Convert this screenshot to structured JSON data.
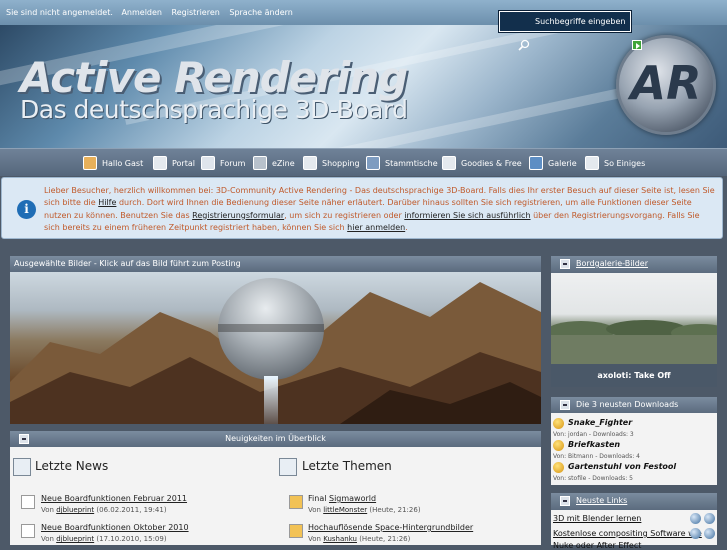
{
  "topbar": {
    "status": "Sie sind nicht angemeldet.",
    "links": [
      "Anmelden",
      "Registrieren",
      "Sprache ändern"
    ]
  },
  "header": {
    "logo_title": "Active Rendering",
    "logo_subtitle": "Das deutschsprachige 3D-Board",
    "badge": "AR",
    "search_placeholder": "Suchbegriffe eingeben"
  },
  "nav": {
    "items": [
      {
        "label": "Hallo Gast",
        "icon": "user-icon"
      },
      {
        "label": "Portal",
        "icon": "home-icon"
      },
      {
        "label": "Forum",
        "icon": "forum-icon"
      },
      {
        "label": "eZine",
        "icon": "ar-icon"
      },
      {
        "label": "Shopping",
        "icon": "cart-icon"
      },
      {
        "label": "Stammtische",
        "icon": "people-icon"
      },
      {
        "label": "Goodies & Free",
        "icon": "gift-icon"
      },
      {
        "label": "Galerie",
        "icon": "gallery-icon"
      },
      {
        "label": "So Einiges",
        "icon": "misc-icon"
      }
    ]
  },
  "notice": {
    "p1": "Lieber Besucher, herzlich willkommen bei: 3D-Community Active Rendering - Das deutschsprachige 3D-Board. Falls dies Ihr erster Besuch auf dieser Seite ist, lesen Sie sich bitte die ",
    "hilfe": "Hilfe",
    "p2": " durch. Dort wird Ihnen die Bedienung dieser Seite näher erläutert. Darüber hinaus sollten Sie sich registrieren, um alle Funktionen dieser Seite nutzen zu können. Benutzen Sie das ",
    "form": "Registrierungsformular",
    "p3": ", um sich zu registrieren oder ",
    "info": "informieren Sie sich ausführlich",
    "p4": " über den Registrierungsvorgang. Falls Sie sich bereits zu einem früheren Zeitpunkt registriert haben, können Sie sich ",
    "anmelden": "hier anmelden",
    "p5": "."
  },
  "featured": {
    "title": "Ausgewählte Bilder - Klick auf das Bild führt zum Posting"
  },
  "news_panel": {
    "title": "Neuigkeiten im Überblick",
    "news_heading": "Letzte News",
    "themes_heading": "Letzte Themen",
    "news": [
      {
        "title": "Neue Boardfunktionen Februar 2011",
        "by": "Von",
        "author": "djblueprint",
        "date": "(06.02.2011, 19:41)"
      },
      {
        "title": "Neue Boardfunktionen Oktober 2010",
        "by": "Von",
        "author": "djblueprint",
        "date": "(17.10.2010, 15:09)"
      }
    ],
    "themes": [
      {
        "title_prefix": "Final ",
        "title": "Sigmaworld",
        "by": "Von",
        "author": "littleMonster",
        "date": "(Heute, 21:26)"
      },
      {
        "title_prefix": "",
        "title": "Hochauflösende Space-Hintergrundbilder",
        "by": "Von",
        "author": "Kushanku",
        "date": "(Heute, 21:26)"
      }
    ]
  },
  "gallery": {
    "title": "Bordgalerie-Bilder",
    "caption": "axoloti: Take Off"
  },
  "downloads": {
    "title": "Die 3 neusten Downloads",
    "items": [
      {
        "name": "Snake_Fighter",
        "meta": "Von: jordan - Downloads: 3"
      },
      {
        "name": "Briefkasten",
        "meta": "Von: Bitmann - Downloads: 4"
      },
      {
        "name": "Gartenstuhl von Festool",
        "meta": "Von: stofile - Downloads: 5"
      }
    ]
  },
  "links": {
    "title": "Neuste Links",
    "items": [
      "3D mit Blender lernen",
      "Kostenlose compositing Software wie",
      "Nuke oder After Effect"
    ]
  }
}
